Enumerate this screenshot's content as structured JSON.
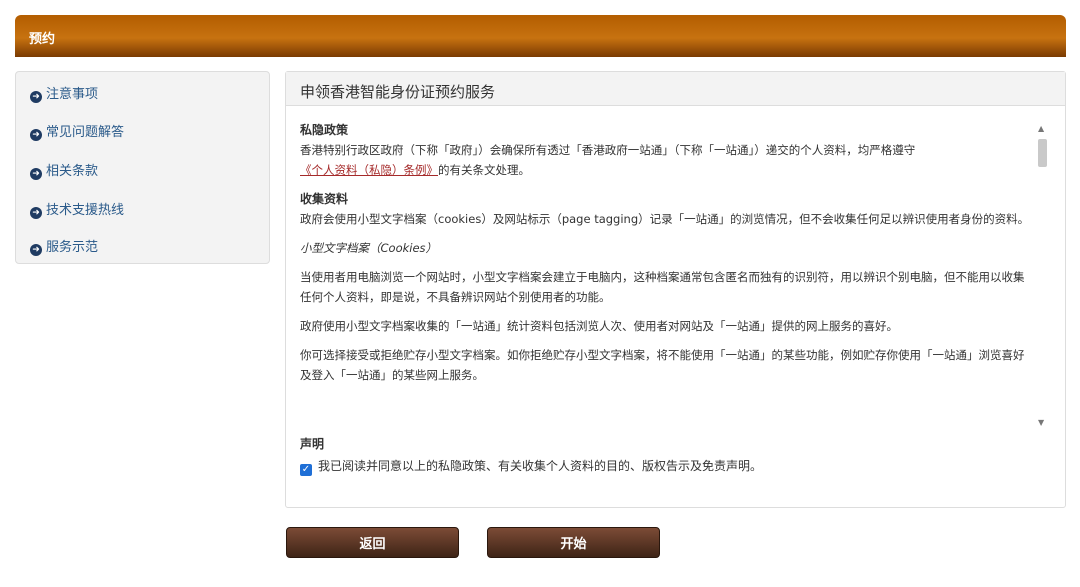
{
  "header": {
    "title": "预约"
  },
  "sidebar": {
    "items": [
      {
        "label": "注意事项"
      },
      {
        "label": "常见问题解答"
      },
      {
        "label": "相关条款"
      },
      {
        "label": "技术支援热线"
      },
      {
        "label": "服务示范"
      }
    ]
  },
  "panel": {
    "title": "申领香港智能身份证预约服务",
    "privacy_heading": "私隐政策",
    "privacy_text_1": "香港特别行政区政府（下称「政府」）会确保所有透过「香港政府一站通」（下称「一站通」）递交的个人资料，均严格遵守",
    "privacy_link": "《个人资料（私隐）条例》",
    "privacy_text_2": "的有关条文处理。",
    "collection_heading": "收集资料",
    "collection_text": "政府会使用小型文字档案（cookies）及网站标示（page tagging）记录「一站通」的浏览情况，但不会收集任何足以辨识使用者身份的资料。",
    "cookies_heading": "小型文字档案（Cookies）",
    "cookies_p1": "当使用者用电脑浏览一个网站时，小型文字档案会建立于电脑内，这种档案通常包含匿名而独有的识别符，用以辨识个别电脑，但不能用以收集任何个人资料，即是说，不具备辨识网站个别使用者的功能。",
    "cookies_p2": "政府使用小型文字档案收集的「一站通」统计资料包括浏览人次、使用者对网站及「一站通」提供的网上服务的喜好。",
    "cookies_p3": "你可选择接受或拒绝贮存小型文字档案。如你拒绝贮存小型文字档案，将不能使用「一站通」的某些功能，例如贮存你使用「一站通」浏览喜好及登入「一站通」的某些网上服务。",
    "declaration_heading": "声明",
    "declaration_checkbox_label": "我已阅读并同意以上的私隐政策、有关收集个人资料的目的、版权告示及免责声明。"
  },
  "buttons": {
    "back": "返回",
    "start": "开始"
  },
  "colors": {
    "header": "#b35d00",
    "button": "#5a3322",
    "link": "#a52a2a",
    "nav": "#2a5a8a"
  }
}
